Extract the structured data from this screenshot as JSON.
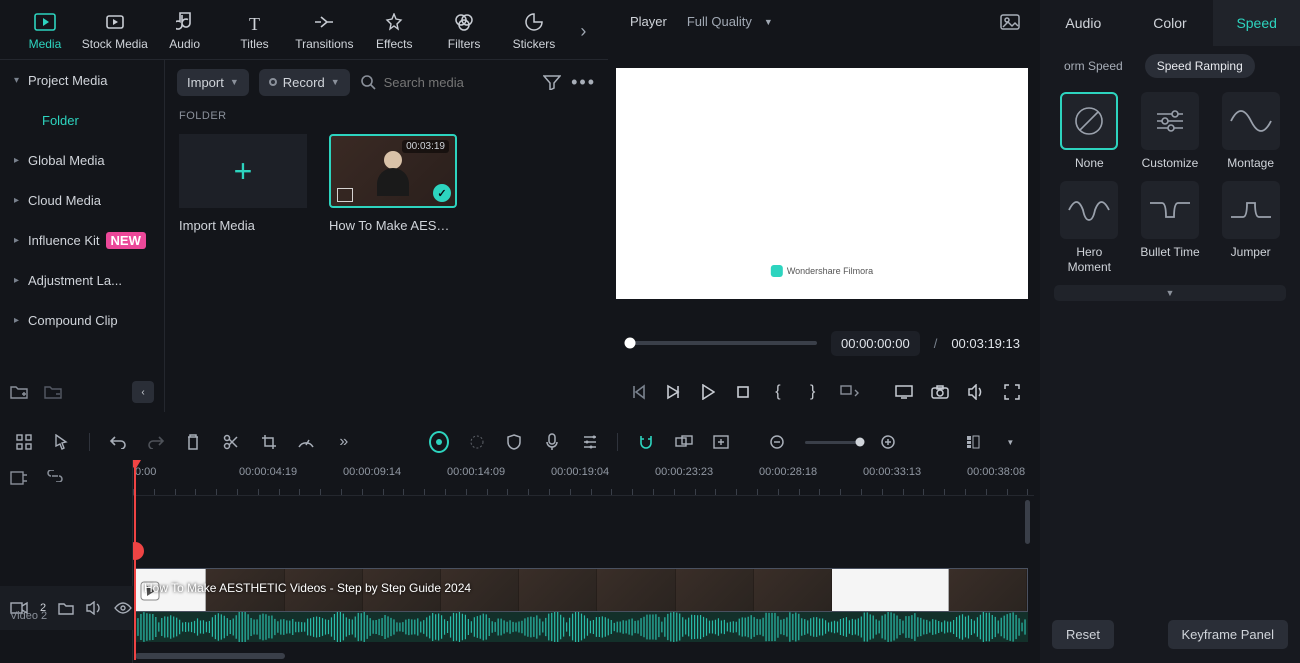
{
  "topnav": {
    "tabs": [
      "Media",
      "Stock Media",
      "Audio",
      "Titles",
      "Transitions",
      "Effects",
      "Filters",
      "Stickers"
    ],
    "active": 0
  },
  "sidebar": {
    "items": [
      {
        "label": "Project Media",
        "expand": "down"
      },
      {
        "label": "Folder",
        "folder": true
      },
      {
        "label": "Global Media",
        "expand": "chev"
      },
      {
        "label": "Cloud Media",
        "expand": "chev"
      },
      {
        "label": "Influence Kit",
        "expand": "chev",
        "badge": "NEW"
      },
      {
        "label": "Adjustment La...",
        "expand": "chev"
      },
      {
        "label": "Compound Clip",
        "expand": "chev"
      }
    ]
  },
  "media_toolbar": {
    "import": "Import",
    "record": "Record",
    "search_placeholder": "Search media"
  },
  "media_panel": {
    "folder_label": "FOLDER",
    "import_card": "Import Media",
    "clip_name": "How To Make AESTHE...",
    "clip_duration": "00:03:19"
  },
  "player": {
    "label": "Player",
    "quality": "Full Quality",
    "watermark": "Wondershare Filmora",
    "current_time": "00:00:00:00",
    "total_time": "00:03:19:13"
  },
  "right_panel": {
    "tabs": [
      "Audio",
      "Color",
      "Speed"
    ],
    "active_tab": 2,
    "subtabs": [
      "orm Speed",
      "Speed Ramping"
    ],
    "active_subtab": 1,
    "presets": [
      {
        "name": "None",
        "kind": "none",
        "selected": true
      },
      {
        "name": "Customize",
        "kind": "sliders"
      },
      {
        "name": "Montage",
        "kind": "wave"
      },
      {
        "name": "Hero Moment",
        "kind": "hero"
      },
      {
        "name": "Bullet Time",
        "kind": "bullet"
      },
      {
        "name": "Jumper",
        "kind": "jumper"
      }
    ],
    "reset": "Reset",
    "keyframe": "Keyframe Panel"
  },
  "timeline": {
    "ruler": [
      "0:00",
      "00:00:04:19",
      "00:00:09:14",
      "00:00:14:09",
      "00:00:19:04",
      "00:00:23:23",
      "00:00:28:18",
      "00:00:33:13",
      "00:00:38:08"
    ],
    "clip_overlay": "How To Make AESTHETIC Videos - Step by Step Guide 2024",
    "track_label": "Video 2",
    "track_num": "2"
  }
}
